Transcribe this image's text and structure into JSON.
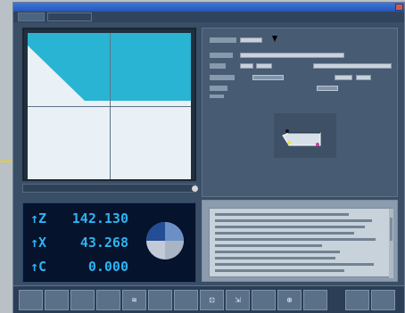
{
  "window": {
    "title": "",
    "tabs": [
      {
        "label": ""
      },
      {
        "label": ""
      }
    ]
  },
  "readout": {
    "axes": [
      {
        "label": "↑Z",
        "value": "142.130"
      },
      {
        "label": "↑X",
        "value": "43.268"
      },
      {
        "label": "↑C",
        "value": "0.000"
      }
    ]
  },
  "plot": {
    "background_color": "#e9f0f6",
    "material_color": "#28b4d2"
  },
  "softkeys": [
    {
      "label": ""
    },
    {
      "label": ""
    },
    {
      "label": ""
    },
    {
      "label": ""
    },
    {
      "label": "≋"
    },
    {
      "label": ""
    },
    {
      "label": ""
    },
    {
      "label": "⊡"
    },
    {
      "label": "⇲"
    },
    {
      "label": ""
    },
    {
      "label": "⊕"
    },
    {
      "label": ""
    },
    {
      "label": ""
    },
    {
      "label": ""
    }
  ]
}
